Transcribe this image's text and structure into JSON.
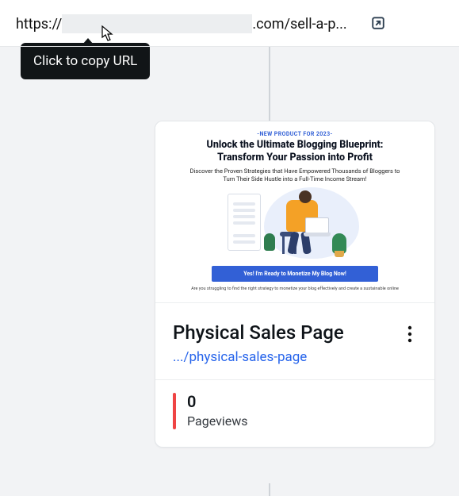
{
  "url": {
    "protocol": "https://",
    "tail": ".com/sell-a-p..."
  },
  "tooltip": "Click to copy URL",
  "preview": {
    "pill": "-NEW PRODUCT FOR 2023-",
    "headline": "Unlock the Ultimate Blogging Blueprint: Transform Your Passion into Profit",
    "subhead": "Discover the Proven Strategies that Have Empowered Thousands of Bloggers to Turn Their Side Hustle into a Full-Time Income Stream!",
    "cta": "Yes! I'm Ready to Monetize My Blog Now!",
    "footer": "Are you struggling to find the right strategy to monetize your blog effectively and create a sustainable online"
  },
  "card": {
    "title": "Physical Sales Page",
    "path": ".../physical-sales-page"
  },
  "stat": {
    "value": "0",
    "label": "Pageviews"
  }
}
